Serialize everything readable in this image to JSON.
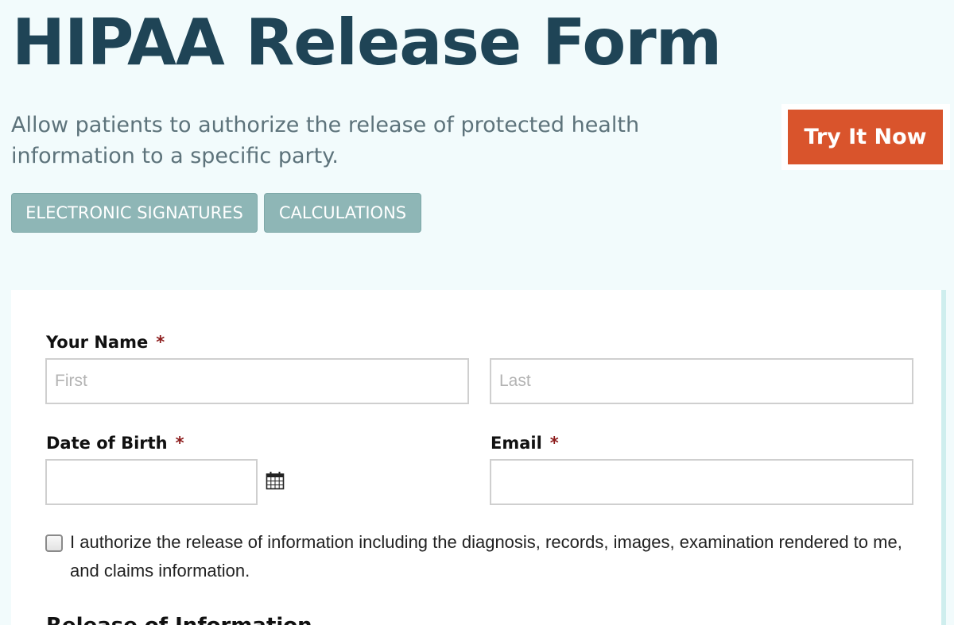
{
  "header": {
    "title": "HIPAA Release Form",
    "subtitle": "Allow patients to authorize the release of protected health information to a specific party.",
    "cta_label": "Try It Now"
  },
  "tags": [
    {
      "label": "ELECTRONIC SIGNATURES"
    },
    {
      "label": "CALCULATIONS"
    }
  ],
  "form": {
    "name": {
      "label": "Your Name",
      "required_marker": "*",
      "first_placeholder": "First",
      "last_placeholder": "Last",
      "first_value": "",
      "last_value": ""
    },
    "dob": {
      "label": "Date of Birth",
      "required_marker": "*",
      "value": "",
      "icon": "calendar-icon"
    },
    "email": {
      "label": "Email",
      "required_marker": "*",
      "value": ""
    },
    "consent": {
      "checked": false,
      "text": "I authorize the release of information including the diagnosis, records, images, examination rendered to me, and claims information."
    },
    "next_section_heading": "Release of Information"
  },
  "colors": {
    "title": "#1f4456",
    "cta": "#d9542c",
    "tag": "#8eb6b6",
    "required": "#8c1b1b",
    "page_background": "#f2fbfc"
  }
}
